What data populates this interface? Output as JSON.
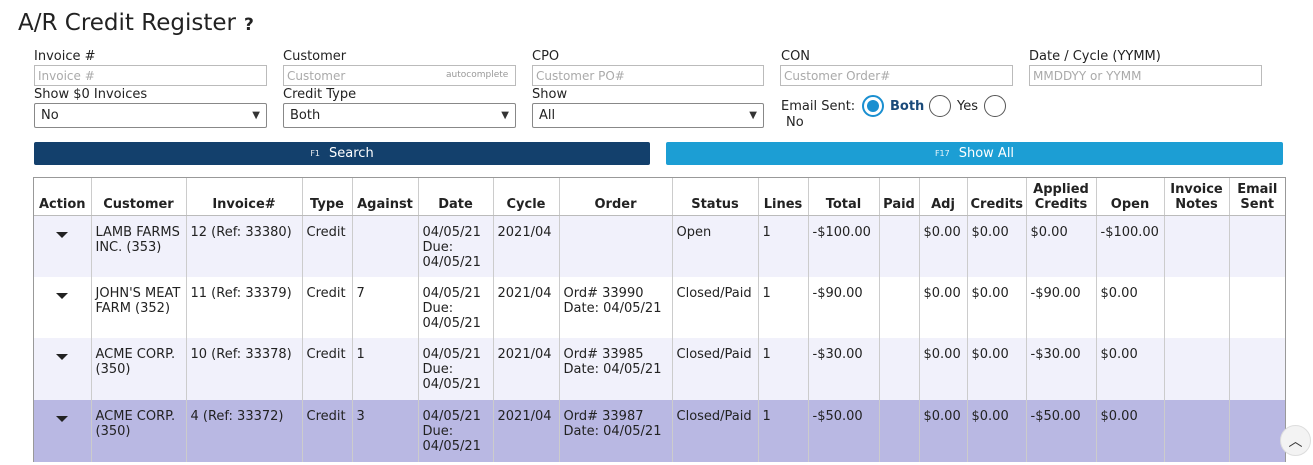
{
  "page": {
    "title": "A/R Credit Register",
    "help": "?"
  },
  "filters": {
    "invoice": {
      "label": "Invoice #",
      "placeholder": "Invoice #"
    },
    "customer": {
      "label": "Customer",
      "placeholder": "Customer",
      "hint": "autocomplete"
    },
    "cpo": {
      "label": "CPO",
      "placeholder": "Customer PO#"
    },
    "con": {
      "label": "CON",
      "placeholder": "Customer Order#"
    },
    "date": {
      "label": "Date / Cycle (YYMM)",
      "placeholder": "MMDDYY or YYMM"
    },
    "show_zero": {
      "label": "Show $0 Invoices",
      "value": "No"
    },
    "credit_type": {
      "label": "Credit Type",
      "value": "Both"
    },
    "show": {
      "label": "Show",
      "value": "All"
    },
    "email_sent": {
      "label": "Email Sent:",
      "options": [
        "Both",
        "Yes",
        "No"
      ],
      "selected": "Both"
    }
  },
  "buttons": {
    "search": {
      "key": "F1",
      "label": "Search"
    },
    "show_all": {
      "key": "F17",
      "label": "Show All"
    }
  },
  "table": {
    "headers": [
      "Action",
      "Customer",
      "Invoice#",
      "Type",
      "Against",
      "Date",
      "Cycle",
      "Order",
      "Status",
      "Lines",
      "Total",
      "Paid",
      "Adj",
      "Credits",
      "Applied Credits",
      "Open",
      "Invoice Notes",
      "Email Sent"
    ],
    "rows": [
      {
        "customer": "LAMB FARMS INC. (353)",
        "invoice": "12 (Ref: 33380)",
        "type": "Credit",
        "against": "",
        "date": "04/05/21",
        "due": "Due: 04/05/21",
        "cycle": "2021/04",
        "order": "",
        "order_date": "",
        "status": "Open",
        "lines": "1",
        "total": "-$100.00",
        "paid": "",
        "adj": "$0.00",
        "credits": "$0.00",
        "applied": "$0.00",
        "open": "-$100.00",
        "notes": "",
        "email": ""
      },
      {
        "customer": "JOHN'S MEAT FARM (352)",
        "invoice": "11 (Ref: 33379)",
        "type": "Credit",
        "against": "7",
        "date": "04/05/21",
        "due": "Due: 04/05/21",
        "cycle": "2021/04",
        "order": "Ord# 33990",
        "order_date": "Date: 04/05/21",
        "status": "Closed/Paid",
        "lines": "1",
        "total": "-$90.00",
        "paid": "",
        "adj": "$0.00",
        "credits": "$0.00",
        "applied": "-$90.00",
        "open": "$0.00",
        "notes": "",
        "email": ""
      },
      {
        "customer": "ACME CORP. (350)",
        "invoice": "10 (Ref: 33378)",
        "type": "Credit",
        "against": "1",
        "date": "04/05/21",
        "due": "Due: 04/05/21",
        "cycle": "2021/04",
        "order": "Ord# 33985",
        "order_date": "Date: 04/05/21",
        "status": "Closed/Paid",
        "lines": "1",
        "total": "-$30.00",
        "paid": "",
        "adj": "$0.00",
        "credits": "$0.00",
        "applied": "-$30.00",
        "open": "$0.00",
        "notes": "",
        "email": ""
      },
      {
        "customer": "ACME CORP. (350)",
        "invoice": "4 (Ref: 33372)",
        "type": "Credit",
        "against": "3",
        "date": "04/05/21",
        "due": "Due: 04/05/21",
        "cycle": "2021/04",
        "order": "Ord# 33987",
        "order_date": "Date: 04/05/21",
        "status": "Closed/Paid",
        "lines": "1",
        "total": "-$50.00",
        "paid": "",
        "adj": "$0.00",
        "credits": "$0.00",
        "applied": "-$50.00",
        "open": "$0.00",
        "notes": "",
        "email": ""
      }
    ]
  },
  "icons": {
    "row_action": "caret-down-icon",
    "scroll": "chevron-up-icon"
  }
}
